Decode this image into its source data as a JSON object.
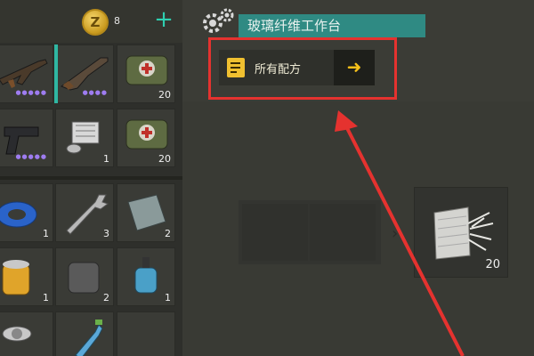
{
  "header": {
    "coin_symbol": "Z",
    "coin_count": "8",
    "add_symbol": "+",
    "station_title": "玻璃纤维工作台"
  },
  "recipe": {
    "label": "所有配方",
    "arrow": "➜"
  },
  "inventory": {
    "slots": [
      {
        "item": "rifle-ak",
        "qty": "",
        "rarity_dots": "●●●●●"
      },
      {
        "item": "shotgun",
        "qty": "",
        "rarity_dots": "●●●●"
      },
      {
        "item": "medkit-bag",
        "qty": "20",
        "rarity_dots": ""
      },
      {
        "item": "pistol",
        "qty": "",
        "rarity_dots": "●●●●●"
      },
      {
        "item": "engine-part",
        "qty": "1",
        "rarity_dots": ""
      },
      {
        "item": "medkit-bag",
        "qty": "20",
        "rarity_dots": ""
      },
      {
        "item": "duct-tape",
        "qty": "1",
        "rarity_dots": ""
      },
      {
        "item": "wrench",
        "qty": "3",
        "rarity_dots": ""
      },
      {
        "item": "metal-plate",
        "qty": "2",
        "rarity_dots": ""
      },
      {
        "item": "oil-filter",
        "qty": "1",
        "rarity_dots": ""
      },
      {
        "item": "rubber-part",
        "qty": "2",
        "rarity_dots": ""
      },
      {
        "item": "water-pump",
        "qty": "1",
        "rarity_dots": ""
      },
      {
        "item": "propeller",
        "qty": "",
        "rarity_dots": ""
      },
      {
        "item": "glass-bottle",
        "qty": "",
        "rarity_dots": ""
      }
    ]
  },
  "output": {
    "item": "fiberglass-roll",
    "qty": "20"
  },
  "colors": {
    "accent_teal": "#2f8a83",
    "highlight_red": "#e5322f",
    "arrow_yellow": "#f5c01a",
    "rarity_purple": "#9e7cf0"
  }
}
